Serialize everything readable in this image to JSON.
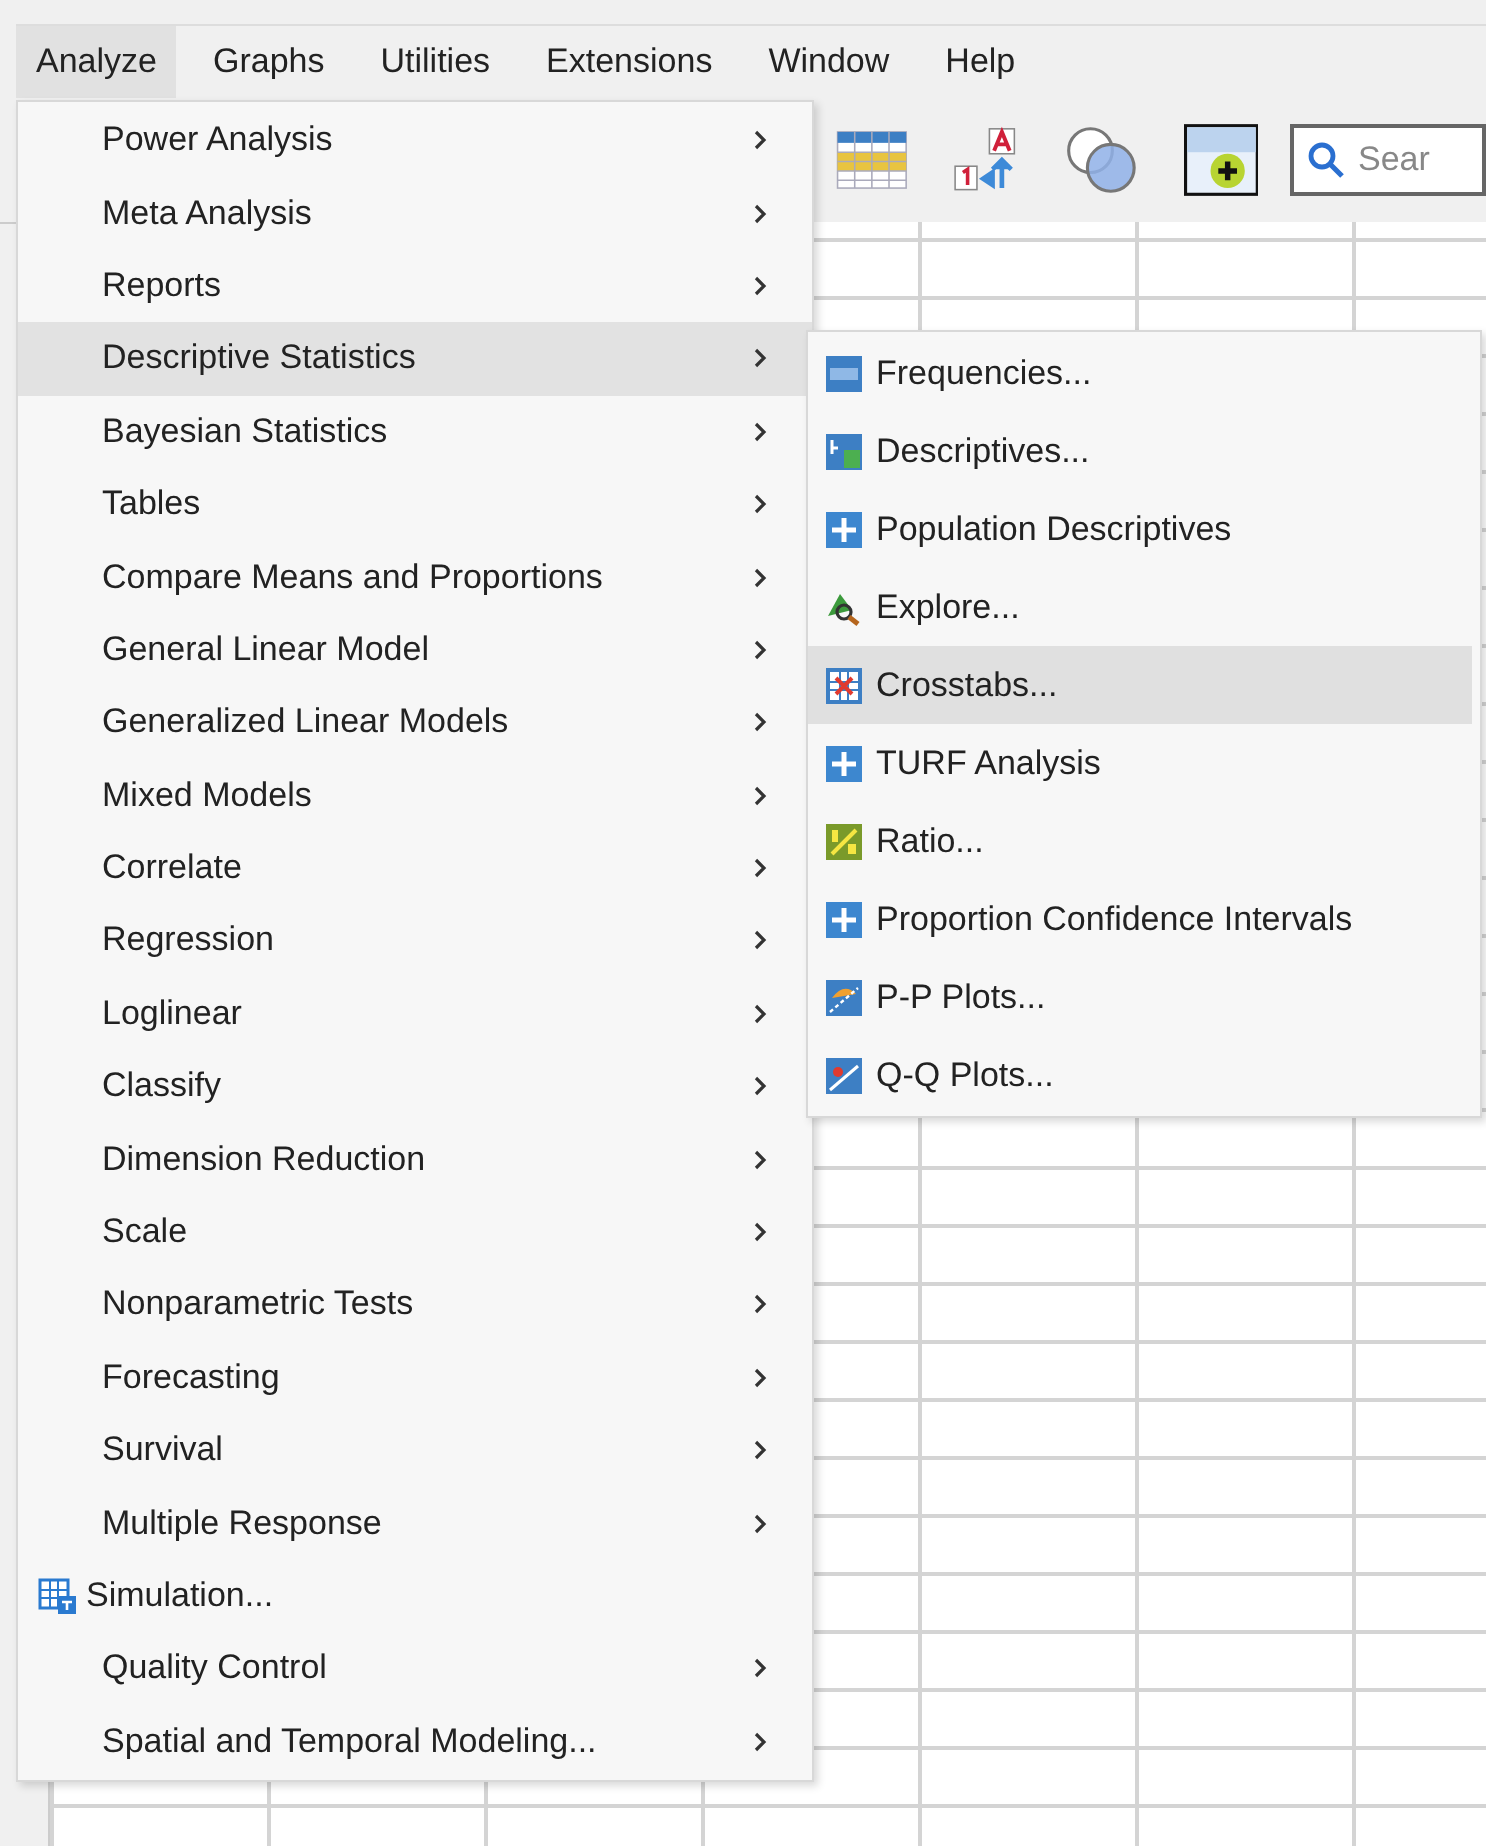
{
  "menubar": [
    {
      "label": "Analyze",
      "selected": true
    },
    {
      "label": "Graphs",
      "selected": false
    },
    {
      "label": "Utilities",
      "selected": false
    },
    {
      "label": "Extensions",
      "selected": false
    },
    {
      "label": "Window",
      "selected": false
    },
    {
      "label": "Help",
      "selected": false
    }
  ],
  "toolbar": {
    "search": {
      "placeholder": "Sear"
    }
  },
  "menu": {
    "items": [
      {
        "label": "Power Analysis",
        "submenu": true,
        "selected": false
      },
      {
        "label": "Meta Analysis",
        "submenu": true,
        "selected": false
      },
      {
        "label": "Reports",
        "submenu": true,
        "selected": false
      },
      {
        "label": "Descriptive Statistics",
        "submenu": true,
        "selected": true
      },
      {
        "label": "Bayesian Statistics",
        "submenu": true,
        "selected": false
      },
      {
        "label": "Tables",
        "submenu": true,
        "selected": false
      },
      {
        "label": "Compare Means and Proportions",
        "submenu": true,
        "selected": false
      },
      {
        "label": "General Linear Model",
        "submenu": true,
        "selected": false
      },
      {
        "label": "Generalized Linear Models",
        "submenu": true,
        "selected": false
      },
      {
        "label": "Mixed Models",
        "submenu": true,
        "selected": false
      },
      {
        "label": "Correlate",
        "submenu": true,
        "selected": false
      },
      {
        "label": "Regression",
        "submenu": true,
        "selected": false
      },
      {
        "label": "Loglinear",
        "submenu": true,
        "selected": false
      },
      {
        "label": "Classify",
        "submenu": true,
        "selected": false
      },
      {
        "label": "Dimension Reduction",
        "submenu": true,
        "selected": false
      },
      {
        "label": "Scale",
        "submenu": true,
        "selected": false
      },
      {
        "label": "Nonparametric Tests",
        "submenu": true,
        "selected": false
      },
      {
        "label": "Forecasting",
        "submenu": true,
        "selected": false
      },
      {
        "label": "Survival",
        "submenu": true,
        "selected": false
      },
      {
        "label": "Multiple Response",
        "submenu": true,
        "selected": false
      },
      {
        "label": "Simulation...",
        "submenu": false,
        "selected": false,
        "kind": "simulation"
      },
      {
        "label": "Quality Control",
        "submenu": true,
        "selected": false
      },
      {
        "label": "Spatial and Temporal Modeling...",
        "submenu": true,
        "selected": false
      }
    ]
  },
  "submenu": {
    "items": [
      {
        "label": "Frequencies...",
        "kind": "frequencies",
        "selected": false
      },
      {
        "label": "Descriptives...",
        "kind": "descriptives",
        "selected": false
      },
      {
        "label": "Population Descriptives",
        "kind": "plus",
        "selected": false
      },
      {
        "label": "Explore...",
        "kind": "explore",
        "selected": false
      },
      {
        "label": "Crosstabs...",
        "kind": "crosstabs",
        "selected": true
      },
      {
        "label": "TURF Analysis",
        "kind": "plus",
        "selected": false
      },
      {
        "label": "Ratio...",
        "kind": "ratio",
        "selected": false
      },
      {
        "label": "Proportion Confidence Intervals",
        "kind": "plus",
        "selected": false
      },
      {
        "label": "P-P Plots...",
        "kind": "pp",
        "selected": false
      },
      {
        "label": "Q-Q Plots...",
        "kind": "qq",
        "selected": false
      }
    ]
  }
}
